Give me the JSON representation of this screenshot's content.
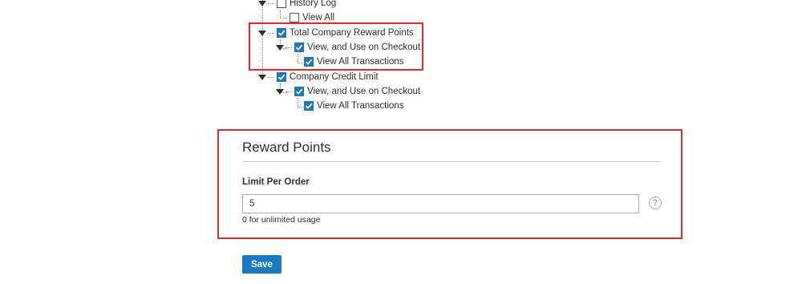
{
  "tree": {
    "history_log": {
      "label": "History Log",
      "checked": false
    },
    "history_view_all": {
      "label": "View All",
      "checked": false
    },
    "total_company_reward_points": {
      "label": "Total Company Reward Points",
      "checked": true
    },
    "reward_view_use_checkout": {
      "label": "View, and Use on Checkout",
      "checked": true
    },
    "reward_view_all_transactions": {
      "label": "View All Transactions",
      "checked": true
    },
    "company_credit_limit": {
      "label": "Company Credit Limit",
      "checked": true
    },
    "credit_view_use_checkout": {
      "label": "View, and Use on Checkout",
      "checked": true
    },
    "credit_view_all_transactions": {
      "label": "View All Transactions",
      "checked": true
    }
  },
  "reward_points": {
    "title": "Reward Points",
    "limit_label": "Limit Per Order",
    "limit_value": "5",
    "limit_note": "0 for unlimited usage",
    "help_icon_glyph": "?"
  },
  "actions": {
    "save_label": "Save"
  },
  "colors": {
    "accent": "#1979c3",
    "highlight": "#e02b27"
  }
}
